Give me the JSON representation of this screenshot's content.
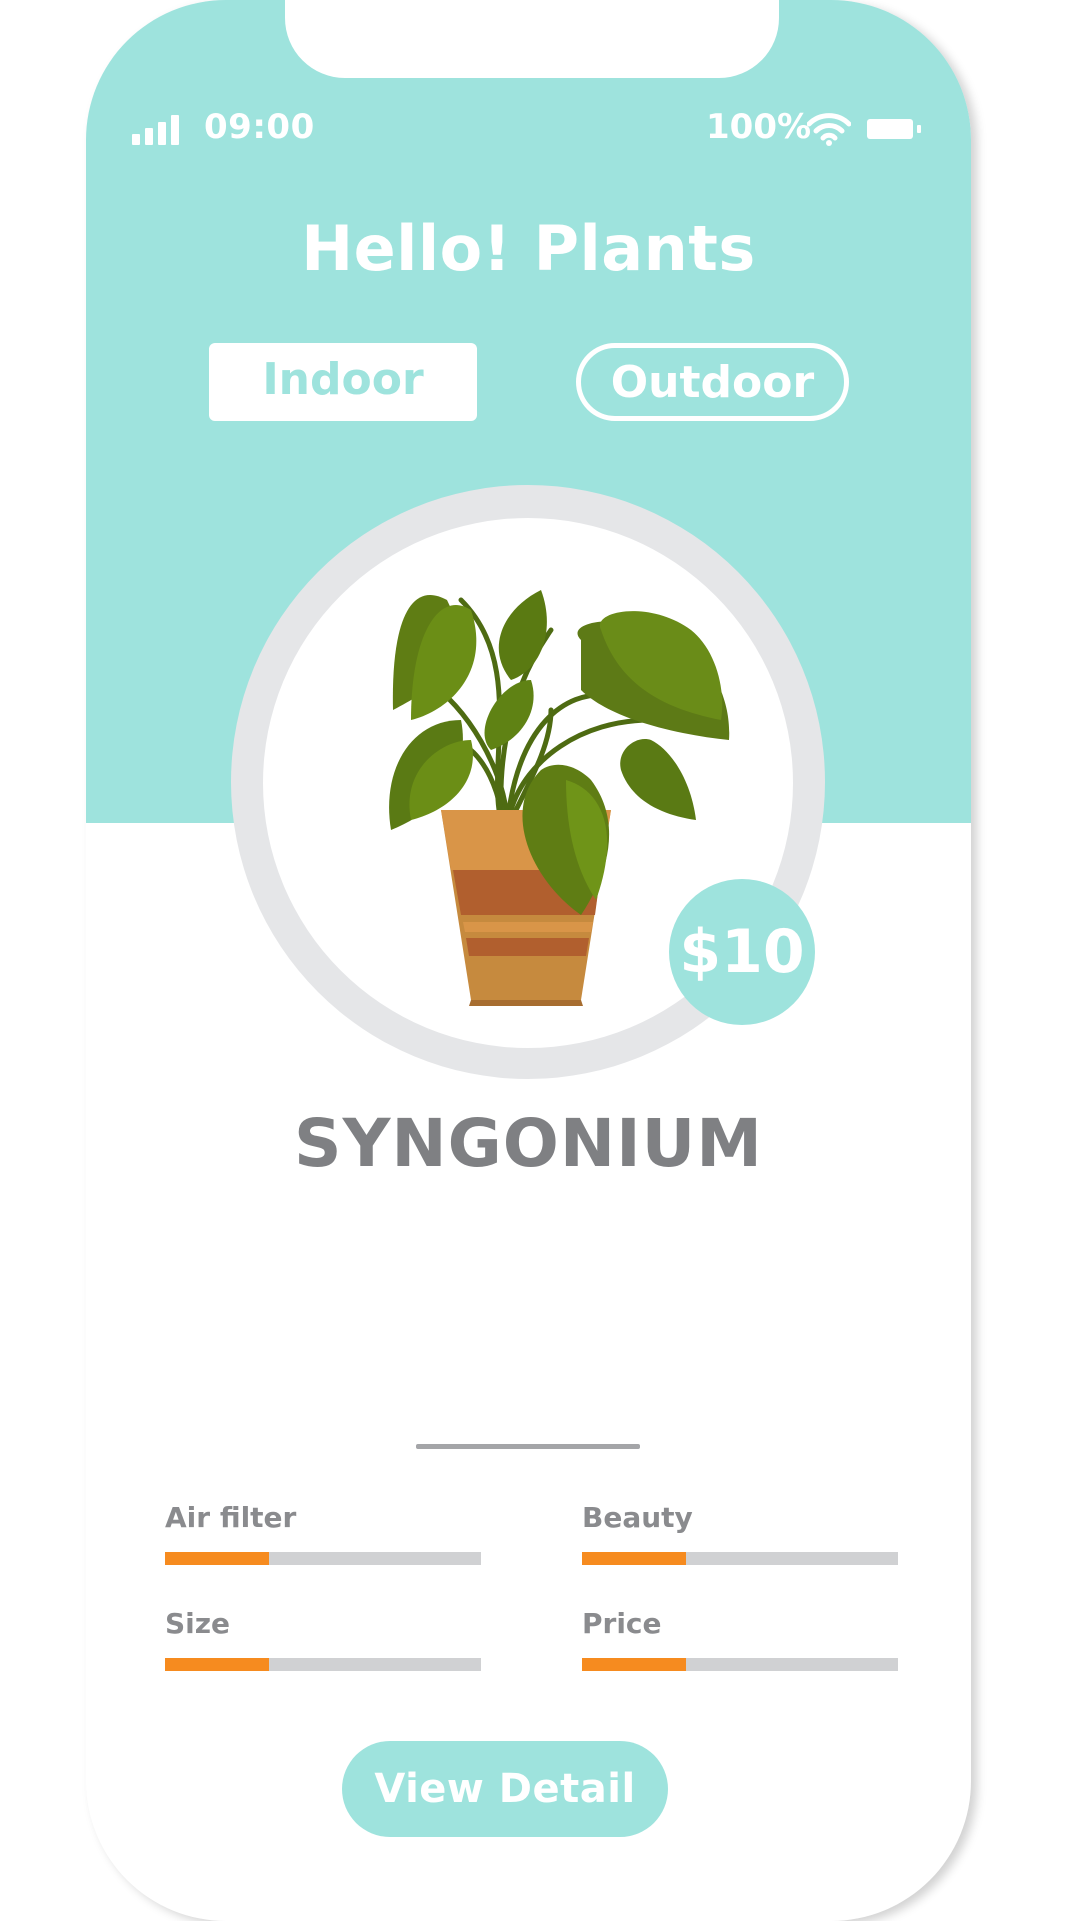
{
  "status_bar": {
    "time": "09:00",
    "battery_percent": "100%"
  },
  "header": {
    "title": "Hello! Plants"
  },
  "tabs": [
    {
      "label": "Indoor",
      "selected": true
    },
    {
      "label": "Outdoor",
      "selected": false
    }
  ],
  "product": {
    "price": "$10",
    "name": "SYNGONIUM",
    "image": "potted-plant-icon"
  },
  "stats": [
    {
      "label": "Air filter",
      "level": 0.33
    },
    {
      "label": "Beauty",
      "level": 0.33
    },
    {
      "label": "Size",
      "level": 0.33
    },
    {
      "label": "Price",
      "level": 0.33
    }
  ],
  "actions": {
    "view_detail_label": "View Detail"
  },
  "colors": {
    "accent": "#9ee3dd",
    "bar_fill": "#f68b1f",
    "bar_track": "#d0d1d3",
    "text_gray": "#7f8083"
  }
}
